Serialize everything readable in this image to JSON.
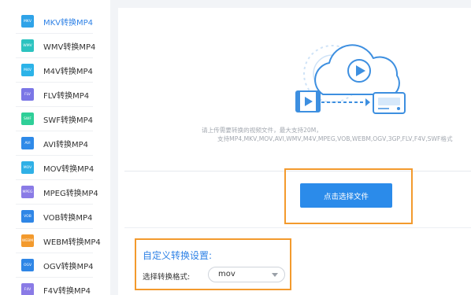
{
  "sidebar": {
    "items": [
      {
        "icon": "MKV",
        "label": "MKV转换MP4",
        "color": "#2fa3e8",
        "active": true
      },
      {
        "icon": "WMV",
        "label": "WMV转换MP4",
        "color": "#2cc3c0"
      },
      {
        "icon": "M4V",
        "label": "M4V转换MP4",
        "color": "#2cb3e8"
      },
      {
        "icon": "FLV",
        "label": "FLV转换MP4",
        "color": "#7b76e6"
      },
      {
        "icon": "SWF",
        "label": "SWF转换MP4",
        "color": "#2fcf98"
      },
      {
        "icon": "AVI",
        "label": "AVI转换MP4",
        "color": "#2f8ae8"
      },
      {
        "icon": "MOV",
        "label": "MOV转换MP4",
        "color": "#2fb0e6"
      },
      {
        "icon": "MPEG",
        "label": "MPEG转换MP4",
        "color": "#8a7be6"
      },
      {
        "icon": "VOB",
        "label": "VOB转换MP4",
        "color": "#2f86e6"
      },
      {
        "icon": "WEBM",
        "label": "WEBM转换MP4",
        "color": "#f39a2d"
      },
      {
        "icon": "OGV",
        "label": "OGV转换MP4",
        "color": "#2f86e6"
      },
      {
        "icon": "F4V",
        "label": "F4V转换MP4",
        "color": "#8a7be6"
      }
    ]
  },
  "upload": {
    "hint_line1": "请上传需要转换的视频文件，最大支持20M，",
    "hint_line2": "支持MP4,MKV,MOV,AVI,WMV,M4V,MPEG,VOB,WEBM,OGV,3GP,FLV,F4V,SWF格式",
    "button_label": "点击选择文件"
  },
  "settings": {
    "title": "自定义转换设置:",
    "format_label": "选择转换格式:",
    "format_value": "mov"
  },
  "colors": {
    "accent": "#2b8bea",
    "highlight": "#f39a2d"
  }
}
